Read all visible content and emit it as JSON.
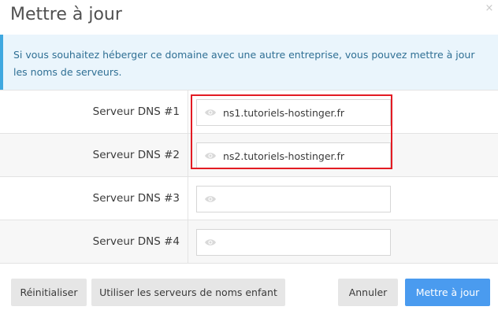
{
  "dialog": {
    "title": "Mettre à jour",
    "close_icon": "×"
  },
  "info": {
    "text": "Si vous souhaitez héberger ce domaine avec une autre entreprise, vous pouvez mettre à jour les noms de serveurs."
  },
  "dns": [
    {
      "label": "Serveur DNS #1",
      "value": "ns1.tutoriels-hostinger.fr"
    },
    {
      "label": "Serveur DNS #2",
      "value": "ns2.tutoriels-hostinger.fr"
    },
    {
      "label": "Serveur DNS #3",
      "value": ""
    },
    {
      "label": "Serveur DNS #4",
      "value": ""
    }
  ],
  "footer": {
    "reset_label": "Réinitialiser",
    "child_label": "Utiliser les serveurs de noms enfant",
    "cancel_label": "Annuler",
    "update_label": "Mettre à jour"
  },
  "colors": {
    "primary": "#4a9bef",
    "info_accent": "#3fa8e0",
    "highlight": "#e31b23"
  },
  "icons": {
    "field_icon": "eye-icon",
    "close": "close-icon"
  }
}
